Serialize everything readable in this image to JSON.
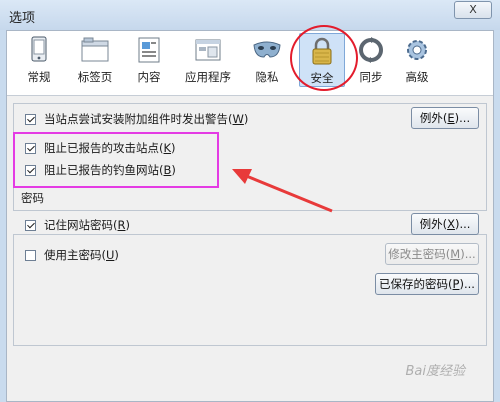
{
  "window": {
    "title": "选项",
    "close_label": "X"
  },
  "toolbar": {
    "tabs": [
      {
        "label": "常规",
        "icon": "general-icon"
      },
      {
        "label": "标签页",
        "icon": "tabs-icon"
      },
      {
        "label": "内容",
        "icon": "content-icon"
      },
      {
        "label": "应用程序",
        "icon": "applications-icon"
      },
      {
        "label": "隐私",
        "icon": "privacy-mask-icon"
      },
      {
        "label": "安全",
        "icon": "lock-icon",
        "selected": true
      },
      {
        "label": "同步",
        "icon": "sync-icon"
      },
      {
        "label": "高级",
        "icon": "gear-icon"
      }
    ]
  },
  "security": {
    "addon_warn": {
      "label": "当站点尝试安装附加组件时发出警告(",
      "key": "W",
      "suffix": ")",
      "checked": true
    },
    "exceptions_label": "例外(",
    "exceptions_key": "E",
    "exceptions_suffix": ")...",
    "block_attack": {
      "label": "阻止已报告的攻击站点(",
      "key": "K",
      "suffix": ")",
      "checked": true
    },
    "block_forgery": {
      "label": "阻止已报告的钓鱼网站(",
      "key": "B",
      "suffix": ")",
      "checked": true
    }
  },
  "passwords": {
    "section_title": "密码",
    "remember": {
      "label": "记住网站密码(",
      "key": "R",
      "suffix": ")",
      "checked": true
    },
    "exceptions_label": "例外(",
    "exceptions_key": "X",
    "exceptions_suffix": ")...",
    "master": {
      "label": "使用主密码(",
      "key": "U",
      "suffix": ")",
      "checked": false
    },
    "change_master_label": "修改主密码(",
    "change_master_key": "M",
    "change_master_suffix": ")...",
    "saved_label": "已保存的密码(",
    "saved_key": "P",
    "saved_suffix": ")..."
  },
  "watermark": "Bai度经验",
  "colors": {
    "highlight_red": "#e31c2c",
    "highlight_magenta": "#e43be4",
    "arrow_red": "#e83a3a"
  }
}
